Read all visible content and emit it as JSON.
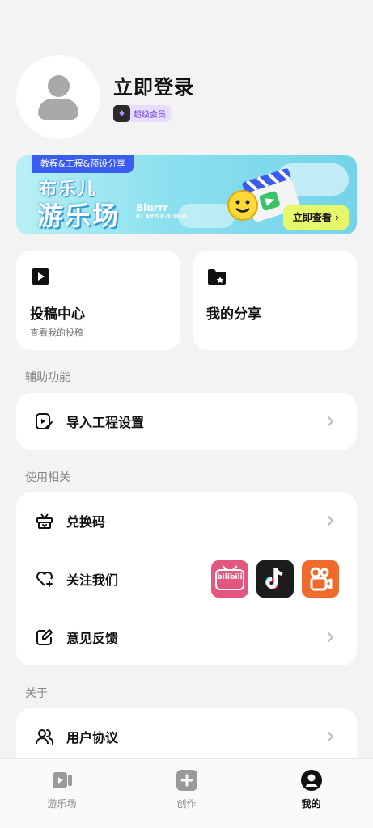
{
  "profile": {
    "login_label": "立即登录",
    "vip_badge": "超级会员"
  },
  "banner": {
    "tag": "教程&工程&预设分享",
    "title_line1": "布乐儿",
    "title_line2": "游乐场",
    "brand_en": "Blurrr",
    "brand_en_sub": "PLAYGROUND",
    "cta": "立即查看 ›"
  },
  "tiles": [
    {
      "title": "投稿中心",
      "subtitle": "查看我的投稿"
    },
    {
      "title": "我的分享"
    }
  ],
  "sections": {
    "assist": {
      "label": "辅助功能",
      "items": [
        {
          "label": "导入工程设置"
        }
      ]
    },
    "usage": {
      "label": "使用相关",
      "items": [
        {
          "label": "兑换码"
        },
        {
          "label": "关注我们"
        },
        {
          "label": "意见反馈"
        }
      ]
    },
    "about": {
      "label": "关于",
      "items": [
        {
          "label": "用户协议"
        }
      ]
    }
  },
  "social": {
    "bilibili_text": "bilibili"
  },
  "tabbar": {
    "tabs": [
      {
        "label": "游乐场"
      },
      {
        "label": "创作"
      },
      {
        "label": "我的"
      }
    ],
    "active": "我的"
  },
  "colors": {
    "background": "#f3f3f3",
    "card": "#ffffff",
    "banner_tag": "#3b5cf0",
    "banner_cta": "#e6f86a",
    "bilibili": "#e3577f",
    "douyin": "#1c1c1c",
    "kuaishou": "#f06a2e"
  }
}
